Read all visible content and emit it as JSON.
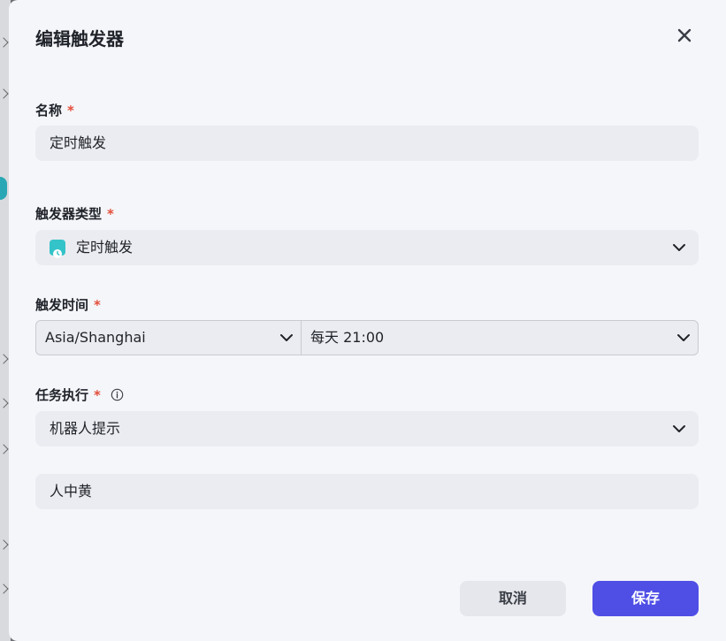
{
  "dialog": {
    "title": "编辑触发器",
    "close_icon": "close-icon"
  },
  "fields": {
    "name": {
      "label": "名称",
      "required_mark": "*",
      "value": "定时触发"
    },
    "trigger_type": {
      "label": "触发器类型",
      "required_mark": "*",
      "value": "定时触发",
      "icon": "clock-icon"
    },
    "trigger_time": {
      "label": "触发时间",
      "required_mark": "*",
      "timezone": "Asia/Shanghai",
      "schedule": "每天 21:00"
    },
    "task": {
      "label": "任务执行",
      "required_mark": "*",
      "info_icon": "info-icon",
      "value": "机器人提示"
    },
    "message": {
      "value": "人中黄"
    }
  },
  "buttons": {
    "cancel": "取消",
    "save": "保存"
  },
  "colors": {
    "primary": "#4f4fe6",
    "required": "#e34d3a",
    "trigger_icon": "#34c3c8"
  }
}
